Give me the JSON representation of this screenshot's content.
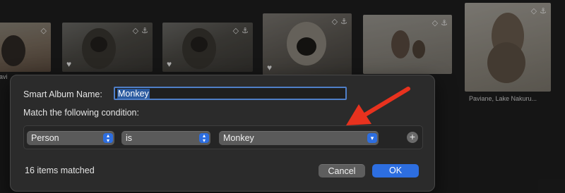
{
  "photos": [
    {
      "id": "p1",
      "caption": "avi"
    },
    {
      "id": "p2"
    },
    {
      "id": "p3"
    },
    {
      "id": "p4"
    },
    {
      "id": "p5"
    },
    {
      "id": "p6",
      "caption": "Paviane, Lake Nakuru..."
    }
  ],
  "dialog": {
    "name_label": "Smart Album Name:",
    "name_value": "Monkey",
    "condition_label": "Match the following condition:",
    "rule": {
      "field": "Person",
      "operator": "is",
      "value": "Monkey"
    },
    "add_symbol": "+",
    "matched_text": "16 items matched",
    "cancel_label": "Cancel",
    "ok_label": "OK"
  },
  "colors": {
    "accent": "#2d6ee0",
    "annotation_arrow": "#e8321e"
  },
  "icons": [
    "heart-icon",
    "tag-icon",
    "location-icon",
    "chevron-updown-icon",
    "chevron-down-icon",
    "plus-icon"
  ]
}
